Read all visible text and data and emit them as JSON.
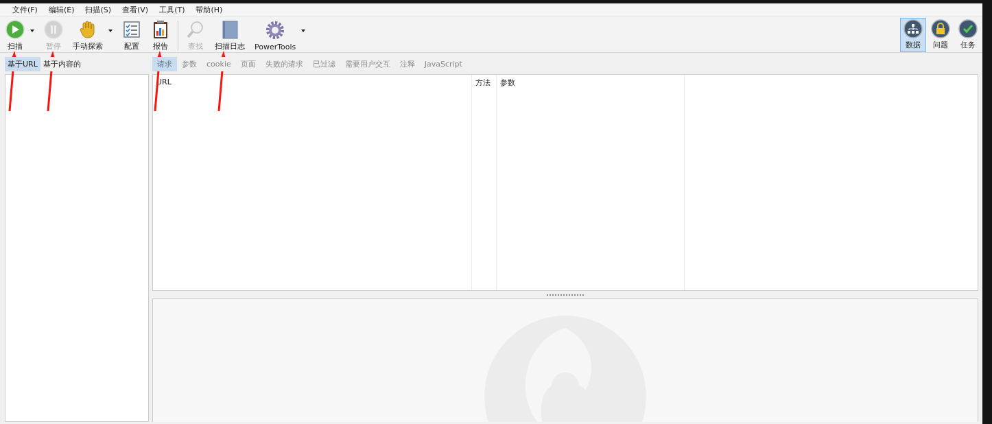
{
  "menu": [
    {
      "label": "文件(F)"
    },
    {
      "label": "编辑(E)"
    },
    {
      "label": "扫描(S)"
    },
    {
      "label": "查看(V)"
    },
    {
      "label": "工具(T)"
    },
    {
      "label": "帮助(H)"
    }
  ],
  "toolbar_groups": [
    {
      "items": [
        {
          "kind": "play",
          "label": "扫描",
          "disabled": false,
          "dropdown": true,
          "marked": true
        },
        {
          "kind": "pause",
          "label": "暂停",
          "disabled": true,
          "dropdown": false,
          "marked": true
        },
        {
          "kind": "hand",
          "label": "手动探索",
          "disabled": false,
          "dropdown": true,
          "marked": false
        },
        {
          "kind": "config",
          "label": "配置",
          "disabled": false,
          "dropdown": false,
          "marked": false
        },
        {
          "kind": "report",
          "label": "报告",
          "disabled": false,
          "dropdown": false,
          "marked": true
        }
      ]
    },
    {
      "items": [
        {
          "kind": "find",
          "label": "查找",
          "disabled": true,
          "dropdown": false,
          "marked": false
        },
        {
          "kind": "log",
          "label": "扫描日志",
          "disabled": false,
          "dropdown": false,
          "marked": true
        },
        {
          "kind": "gear",
          "label": "PowerTools",
          "disabled": false,
          "dropdown": true,
          "marked": false
        }
      ]
    }
  ],
  "views": [
    {
      "kind": "tree",
      "label": "数据",
      "selected": true
    },
    {
      "kind": "lock",
      "label": "问题",
      "selected": false
    },
    {
      "kind": "check",
      "label": "任务",
      "selected": false
    }
  ],
  "left_tabs": [
    {
      "label": "基于URL",
      "selected": true
    },
    {
      "label": "基于内容的",
      "selected": false
    }
  ],
  "data_tabs": [
    {
      "label": "请求",
      "selected": true
    },
    {
      "label": "参数",
      "selected": false
    },
    {
      "label": "cookie",
      "selected": false
    },
    {
      "label": "页面",
      "selected": false
    },
    {
      "label": "失败的请求",
      "selected": false
    },
    {
      "label": "已过滤",
      "selected": false
    },
    {
      "label": "需要用户交互",
      "selected": false
    },
    {
      "label": "注释",
      "selected": false
    },
    {
      "label": "JavaScript",
      "selected": false
    }
  ],
  "table": {
    "columns": [
      "URL",
      "方法",
      "参数"
    ]
  }
}
